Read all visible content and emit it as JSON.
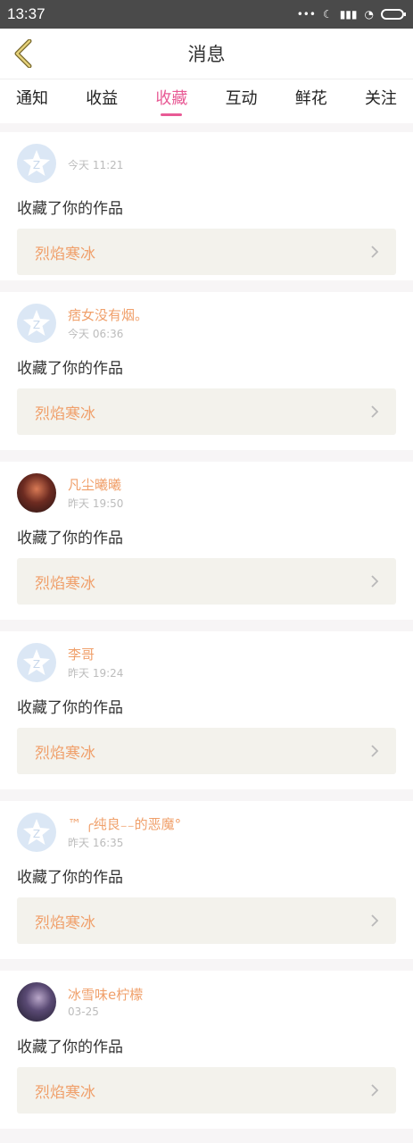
{
  "status": {
    "time": "13:37",
    "icons": [
      "dots-icon",
      "moon-icon",
      "signal-icon",
      "wifi-icon",
      "battery-icon"
    ]
  },
  "header": {
    "title": "消息"
  },
  "tabs": [
    {
      "label": "通知",
      "active": false
    },
    {
      "label": "收益",
      "active": false
    },
    {
      "label": "收藏",
      "active": true
    },
    {
      "label": "互动",
      "active": false
    },
    {
      "label": "鲜花",
      "active": false
    },
    {
      "label": "关注",
      "active": false
    }
  ],
  "notifications": [
    {
      "username": "",
      "time": "今天 11:21",
      "action": "收藏了你的作品",
      "work": "烈焰寒冰",
      "avatar": "default"
    },
    {
      "username": "痞女没有烟。",
      "time": "今天 06:36",
      "action": "收藏了你的作品",
      "work": "烈焰寒冰",
      "avatar": "default"
    },
    {
      "username": "凡尘曦曦",
      "time": "昨天 19:50",
      "action": "收藏了你的作品",
      "work": "烈焰寒冰",
      "avatar": "anime1"
    },
    {
      "username": "李哥",
      "time": "昨天 19:24",
      "action": "收藏了你的作品",
      "work": "烈焰寒冰",
      "avatar": "default"
    },
    {
      "username": "™ ╭纯良₋₋的恶魔°",
      "time": "昨天 16:35",
      "action": "收藏了你的作品",
      "work": "烈焰寒冰",
      "avatar": "default"
    },
    {
      "username": "冰雪味e柠檬",
      "time": "03-25",
      "action": "收藏了你的作品",
      "work": "烈焰寒冰",
      "avatar": "anime2"
    }
  ]
}
